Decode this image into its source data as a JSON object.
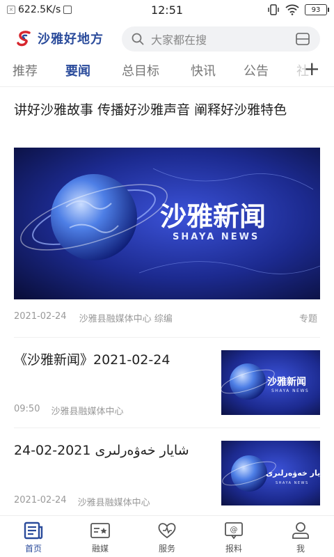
{
  "status_bar": {
    "speed": "622.5K/s",
    "time": "12:51",
    "battery": "93"
  },
  "header": {
    "logo_text": "沙雅好地方",
    "search_placeholder": "大家都在搜"
  },
  "tabs": [
    {
      "label": "推荐"
    },
    {
      "label": "要闻"
    },
    {
      "label": "总目标"
    },
    {
      "label": "快讯"
    },
    {
      "label": "公告"
    },
    {
      "label": "社"
    }
  ],
  "tab_plus": "+",
  "feature": {
    "title": "讲好沙雅故事 传播好沙雅声音 阐释好沙雅特色",
    "image_title": "沙雅新闻",
    "image_subtitle": "SHAYA NEWS",
    "date": "2021-02-24",
    "source": "沙雅县融媒体中心 综编",
    "tag": "专题"
  },
  "items": [
    {
      "title": "《沙雅新闻》2021-02-24",
      "time": "09:50",
      "source": "沙雅县融媒体中心",
      "thumb_title": "沙雅新闻",
      "thumb_subtitle": "SHAYA NEWS"
    },
    {
      "title": "شايار خەۋەرلىرى 2021-02-24",
      "time": "2021-02-24",
      "source": "沙雅县融媒体中心",
      "thumb_title": "شايار خەۋەرلىرى",
      "thumb_subtitle": "SHAYA NEWS"
    }
  ],
  "bottom_nav": [
    {
      "label": "首页",
      "icon": "news-icon"
    },
    {
      "label": "融媒",
      "icon": "media-icon"
    },
    {
      "label": "服务",
      "icon": "heart-icon"
    },
    {
      "label": "报料",
      "icon": "report-icon"
    },
    {
      "label": "我",
      "icon": "user-icon"
    }
  ],
  "colors": {
    "accent": "#2a4b9b",
    "text": "#222222",
    "muted": "#999999"
  }
}
